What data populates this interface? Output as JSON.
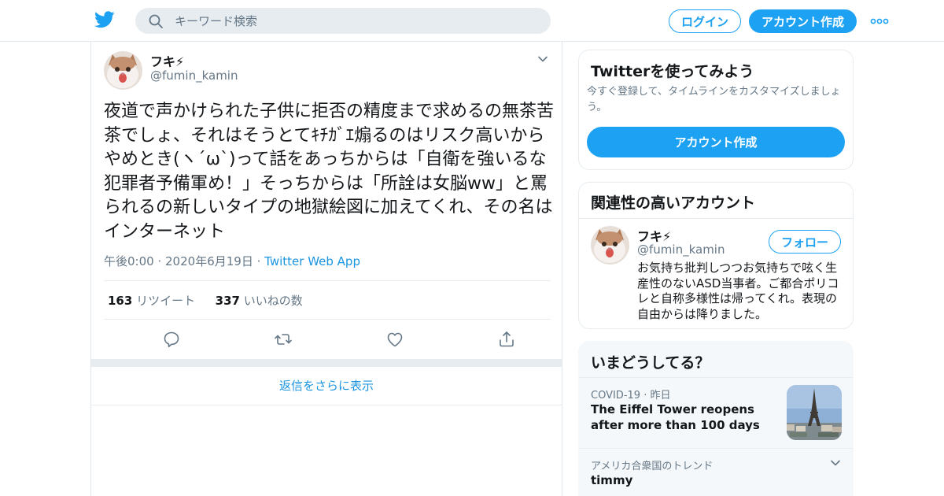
{
  "header": {
    "search_placeholder": "キーワード検索",
    "login_label": "ログイン",
    "signup_label": "アカウント作成"
  },
  "tweet": {
    "name": "フキ⚡",
    "handle": "@fumin_kamin",
    "text": "夜道で声かけられた子供に拒否の精度まで求めるの無茶苦茶でしょ、それはそうとてｷﾁｶﾞｴ煽るのはリスク高いからやめとき(ヽ´ω`)って話をあっちからは「自衛を強いるな犯罪者予備軍め！」そっちからは「所詮は女脳ww」と罵られるの新しいタイプの地獄絵図に加えてくれ、その名はインターネット",
    "time": "午後0:00",
    "date": "2020年6月19日",
    "via": "Twitter Web App",
    "retweets_count": "163",
    "retweets_label": "リツイート",
    "likes_count": "337",
    "likes_label": "いいねの数",
    "more_replies": "返信をさらに表示"
  },
  "sidebar": {
    "signup_card": {
      "title": "Twitterを使ってみよう",
      "description": "今すぐ登録して、タイムラインをカスタマイズしましょう。",
      "button": "アカウント作成"
    },
    "related": {
      "title": "関連性の高いアカウント",
      "name": "フキ⚡",
      "handle": "@fumin_kamin",
      "follow_label": "フォロー",
      "bio": "お気持ち批判しつつお気持ちで呟く生産性のないASD当事者。ご都合ポリコレと自称多様性は帰ってくれ。表現の自由からは降りました。"
    },
    "trends": {
      "title": "いまどうしてる？",
      "item1_category": "COVID-19",
      "item1_time": "昨日",
      "item1_headline": "The Eiffel Tower reopens after more than 100 days",
      "item2_context": "アメリカ合衆国のトレンド",
      "item2_name": "timmy"
    }
  },
  "colors": {
    "accent": "#1da1f2",
    "link": "#1b95e0",
    "secondary_text": "#657786",
    "divider": "#e6ecf0"
  }
}
